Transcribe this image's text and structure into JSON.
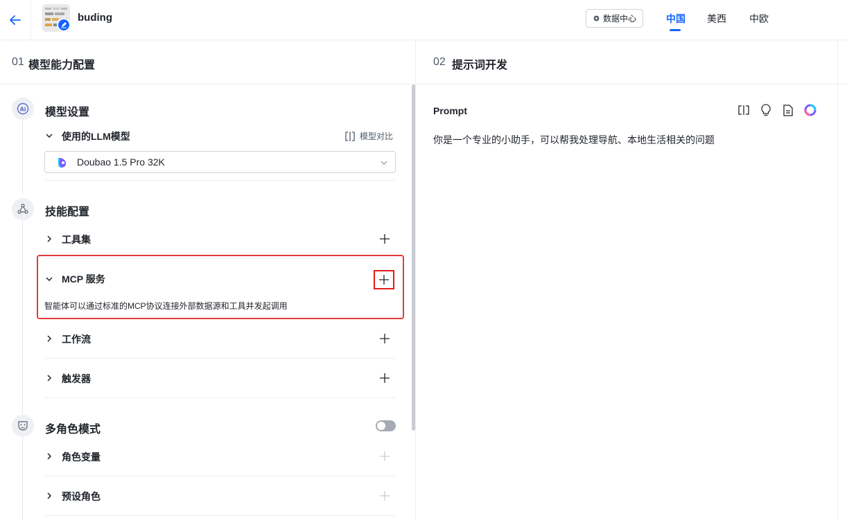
{
  "header": {
    "app_name": "buding",
    "data_center_label": "数据中心",
    "regions": [
      {
        "label": "中国",
        "active": true
      },
      {
        "label": "美西",
        "active": false
      },
      {
        "label": "中欧",
        "active": false
      }
    ]
  },
  "left_panel": {
    "number": "01",
    "title": "模型能力配置",
    "model_settings": {
      "title": "模型设置",
      "icon": "ai-icon",
      "llm_label": "使用的LLM模型",
      "compare_label": "模型对比",
      "selected_model": "Doubao 1.5 Pro 32K"
    },
    "skills": {
      "title": "技能配置",
      "icon": "nodes-icon",
      "items": [
        {
          "label": "工具集",
          "expanded": false
        },
        {
          "label": "MCP 服务",
          "expanded": true,
          "description": "智能体可以通过标准的MCP协议连接外部数据源和工具并发起调用"
        },
        {
          "label": "工作流",
          "expanded": false
        },
        {
          "label": "触发器",
          "expanded": false
        }
      ]
    },
    "multi_role": {
      "title": "多角色模式",
      "icon": "mask-icon",
      "toggle_on": false,
      "items": [
        {
          "label": "角色变量"
        },
        {
          "label": "预设角色"
        }
      ]
    }
  },
  "right_panel": {
    "number": "02",
    "title": "提示词开发",
    "prompt_label": "Prompt",
    "prompt_text": "你是一个专业的小助手，可以帮我处理导航、本地生活相关的问题",
    "tool_icons": [
      "compare-icon",
      "lightbulb-icon",
      "document-icon",
      "ai-assist-icon"
    ]
  },
  "colors": {
    "accent": "#1664ff",
    "highlight": "#e23b3b"
  }
}
